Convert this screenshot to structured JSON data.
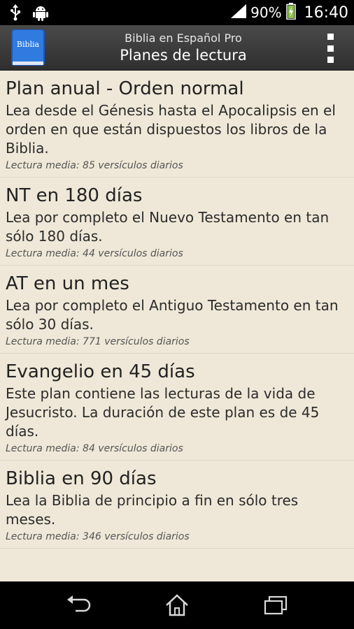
{
  "status_bar": {
    "battery_text": "90%",
    "time": "16:40",
    "icons": [
      "usb-icon",
      "android-icon",
      "signal-icon",
      "battery-icon"
    ]
  },
  "action_bar": {
    "app_icon_label": "Biblia",
    "app_name": "Biblia en Español Pro",
    "title": "Planes de lectura"
  },
  "plans": [
    {
      "title": "Plan anual - Orden normal",
      "description": "Lea desde el Génesis hasta el Apocalipsis en el orden en que están dispuestos los libros de la Biblia.",
      "meta": "Lectura media: 85 versículos diarios"
    },
    {
      "title": "NT en 180 días",
      "description": "Lea por completo el Nuevo Testamento en tan sólo 180 días.",
      "meta": "Lectura media: 44 versículos diarios"
    },
    {
      "title": "AT en un mes",
      "description": "Lea por completo el Antiguo Testamento en tan sólo 30 días.",
      "meta": "Lectura media: 771 versículos diarios"
    },
    {
      "title": "Evangelio en 45 días",
      "description": "Este plan contiene las lecturas de la vida de Jesucristo. La duración de este plan es de 45 días.",
      "meta": "Lectura media: 84 versículos diarios"
    },
    {
      "title": "Biblia en 90 días",
      "description": "Lea la Biblia de principio a fin en sólo tres meses.",
      "meta": "Lectura media: 346 versículos diarios"
    }
  ],
  "colors": {
    "background": "#efe8d8",
    "action_bar": "#3a3a3a",
    "status_bar": "#000000",
    "accent_icon": "#2a6fd6",
    "battery_charge": "#8bc34a"
  }
}
